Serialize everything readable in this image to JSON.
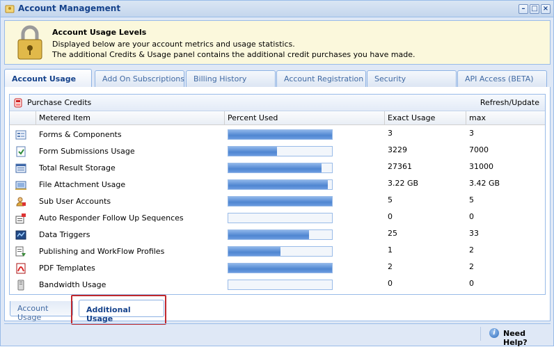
{
  "window": {
    "title": "Account Management"
  },
  "info": {
    "heading": "Account Usage Levels",
    "line1": "Displayed below are your account metrics and usage statistics.",
    "line2": "The additional Credits & Usage panel contains the additional credit purchases you have made."
  },
  "tabs": [
    {
      "label": "Account Usage",
      "active": true
    },
    {
      "label": "Add On Subscriptions"
    },
    {
      "label": "Billing History"
    },
    {
      "label": "Account Registration"
    },
    {
      "label": "Security"
    },
    {
      "label": "API Access (BETA)"
    }
  ],
  "toolbar": {
    "purchase_label": "Purchase Credits",
    "refresh_label": "Refresh/Update"
  },
  "columns": [
    "Metered Item",
    "Percent Used",
    "Exact Usage",
    "max"
  ],
  "rows": [
    {
      "icon": "forms-icon",
      "item": "Forms & Components",
      "percent": 1.0,
      "exact": "3",
      "max": "3"
    },
    {
      "icon": "form-submissions-icon",
      "item": "Form Submissions Usage",
      "percent": 0.47,
      "exact": "3229",
      "max": "7000"
    },
    {
      "icon": "storage-icon",
      "item": "Total Result Storage",
      "percent": 0.9,
      "exact": "27361",
      "max": "31000"
    },
    {
      "icon": "file-attachment-icon",
      "item": "File Attachment Usage",
      "percent": 0.96,
      "exact": "3.22 GB",
      "max": "3.42 GB"
    },
    {
      "icon": "sub-user-icon",
      "item": "Sub User Accounts",
      "percent": 1.0,
      "exact": "5",
      "max": "5"
    },
    {
      "icon": "auto-responder-icon",
      "item": "Auto Responder Follow Up Sequences",
      "percent": 0,
      "exact": "0",
      "max": "0"
    },
    {
      "icon": "data-triggers-icon",
      "item": "Data Triggers",
      "percent": 0.78,
      "exact": "25",
      "max": "33"
    },
    {
      "icon": "workflow-icon",
      "item": "Publishing and WorkFlow Profiles",
      "percent": 0.5,
      "exact": "1",
      "max": "2"
    },
    {
      "icon": "pdf-icon",
      "item": "PDF Templates",
      "percent": 1.0,
      "exact": "2",
      "max": "2"
    },
    {
      "icon": "bandwidth-icon",
      "item": "Bandwidth Usage",
      "percent": 0,
      "exact": "0",
      "max": "0"
    }
  ],
  "bottom_tabs": [
    {
      "label": "Account Usage"
    },
    {
      "label": "Additional Usage",
      "active": true
    }
  ],
  "footer": {
    "help_label": "Need Help?"
  }
}
